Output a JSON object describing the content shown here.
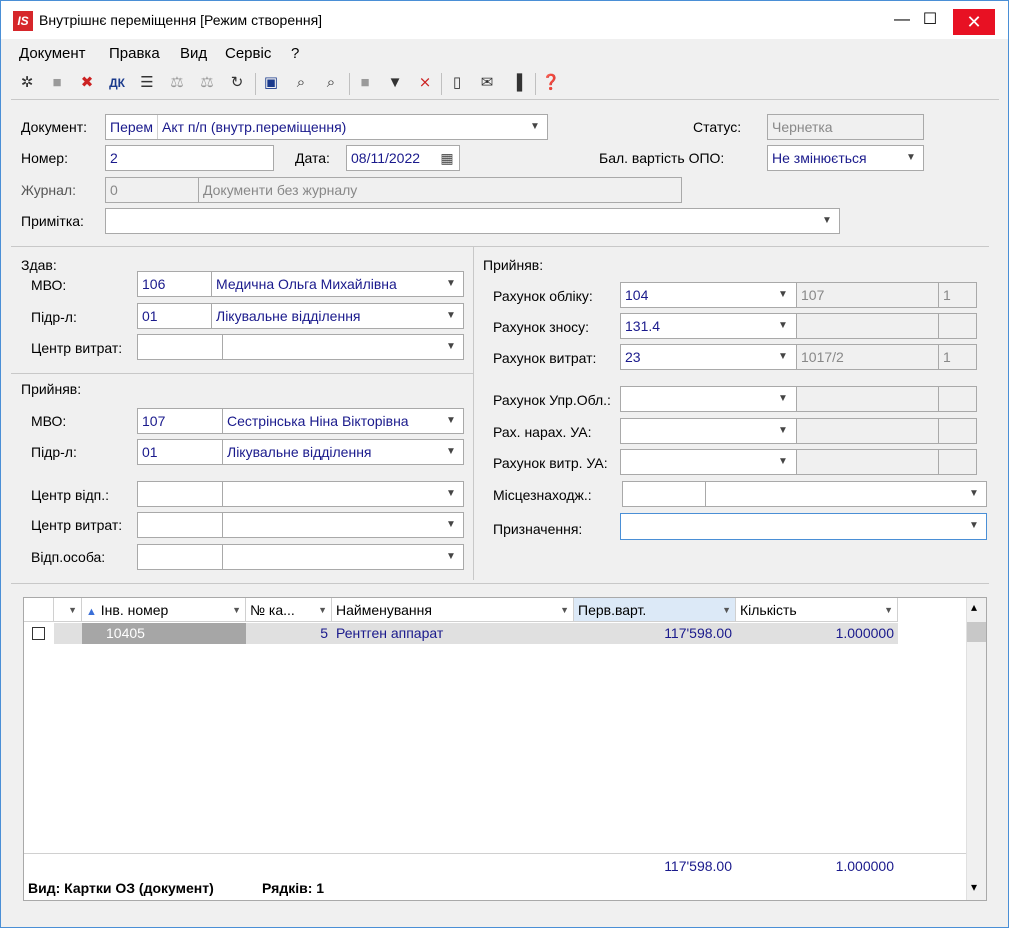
{
  "window": {
    "title": "Внутрішнє переміщення [Режим створення]",
    "logo": "IS",
    "accent": "#4a8fd6",
    "close_color": "#e81123"
  },
  "menu": {
    "items": [
      "Документ",
      "Правка",
      "Вид",
      "Сервіс",
      "?"
    ]
  },
  "toolbar": {
    "icons": [
      "new-doc-icon",
      "copy-icon",
      "delete-icon",
      "dk-icon",
      "list-icon",
      "post-icon",
      "unpost-icon",
      "refresh-icon",
      "save-icon",
      "find-icon",
      "find-next-icon",
      "block-icon",
      "filter-icon",
      "clear-filter-icon",
      "form-icon",
      "mail-icon",
      "barcode-icon",
      "help-icon"
    ]
  },
  "header": {
    "document_label": "Документ:",
    "document_code": "Перем",
    "document_type": "Акт п/п (внутр.переміщення)",
    "status_label": "Статус:",
    "status_value": "Чернетка",
    "number_label": "Номер:",
    "number_value": "2",
    "date_label": "Дата:",
    "date_value": "08/11/2022",
    "balance_label": "Бал. вартість ОПО:",
    "balance_value": "Не змінюється",
    "journal_label": "Журнал:",
    "journal_code": "0",
    "journal_name": "Документи без журналу",
    "note_label": "Примітка:",
    "note_value": ""
  },
  "gave": {
    "section_label": "Здав:",
    "mvo_label": "МВО:",
    "mvo_code": "106",
    "mvo_name": "Медична Ольга Михайлівна",
    "dept_label": "Підр-л:",
    "dept_code": "01",
    "dept_name": "Лікувальне відділення",
    "cost_center_label": "Центр витрат:",
    "cost_center_code": "",
    "cost_center_name": ""
  },
  "received": {
    "section_label": "Прийняв:",
    "mvo_label": "МВО:",
    "mvo_code": "107",
    "mvo_name": "Сестрінська Ніна Вікторівна",
    "dept_label": "Підр-л:",
    "dept_code": "01",
    "dept_name": "Лікувальне відділення",
    "resp_center_label": "Центр відп.:",
    "cost_center_label": "Центр витрат:",
    "resp_person_label": "Відп.особа:"
  },
  "accounts": {
    "section_label": "Прийняв:",
    "account_label": "Рахунок обліку:",
    "account_value": "104",
    "account_extra": "107",
    "account_extra2": "1",
    "wear_label": "Рахунок зносу:",
    "wear_value": "131.4",
    "expense_label": "Рахунок витрат:",
    "expense_value": "23",
    "expense_extra": "1017/2",
    "expense_extra2": "1",
    "mgmt_label": "Рахунок Упр.Обл.:",
    "accrual_label": "Рах. нарах. УА:",
    "expense_ua_label": "Рахунок витр. УА:",
    "location_label": "Місцезнаходж.:",
    "purpose_label": "Призначення:"
  },
  "grid": {
    "columns": [
      "",
      "Інв. номер",
      "№ ка...",
      "Найменування",
      "Перв.варт.",
      "Кількість"
    ],
    "rows": [
      {
        "inv": "10405",
        "card": "5",
        "name": "Рентген аппарат",
        "cost": "117'598.00",
        "qty": "1.000000"
      }
    ],
    "totals": {
      "cost": "117'598.00",
      "qty": "1.000000"
    },
    "view_label": "Вид: Картки ОЗ (документ)",
    "rows_label": "Рядків: 1"
  }
}
